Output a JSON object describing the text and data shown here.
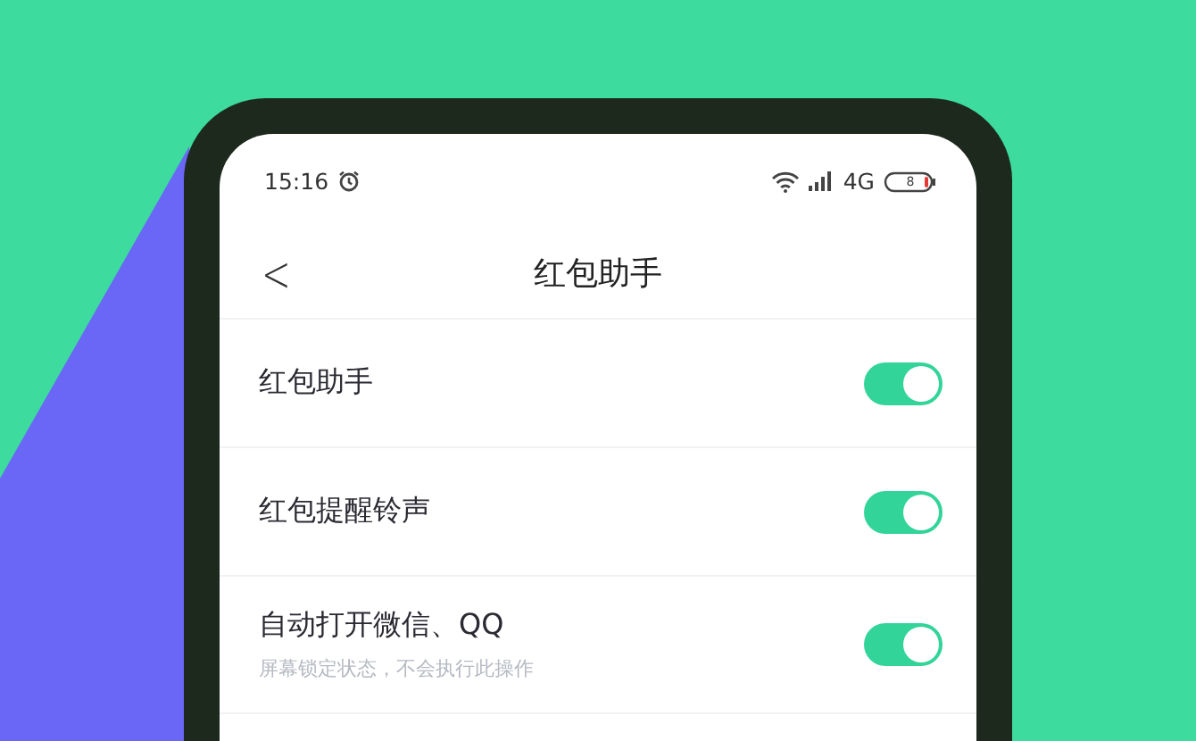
{
  "status_bar": {
    "time": "15:16",
    "network": "4G",
    "battery": "8"
  },
  "nav": {
    "back": "<",
    "title": "红包助手"
  },
  "settings": [
    {
      "label": "红包助手",
      "on": true
    },
    {
      "label": "红包提醒铃声",
      "on": true
    },
    {
      "label": "自动打开微信、QQ",
      "hint": "屏幕锁定状态，不会执行此操作",
      "on": true
    }
  ]
}
